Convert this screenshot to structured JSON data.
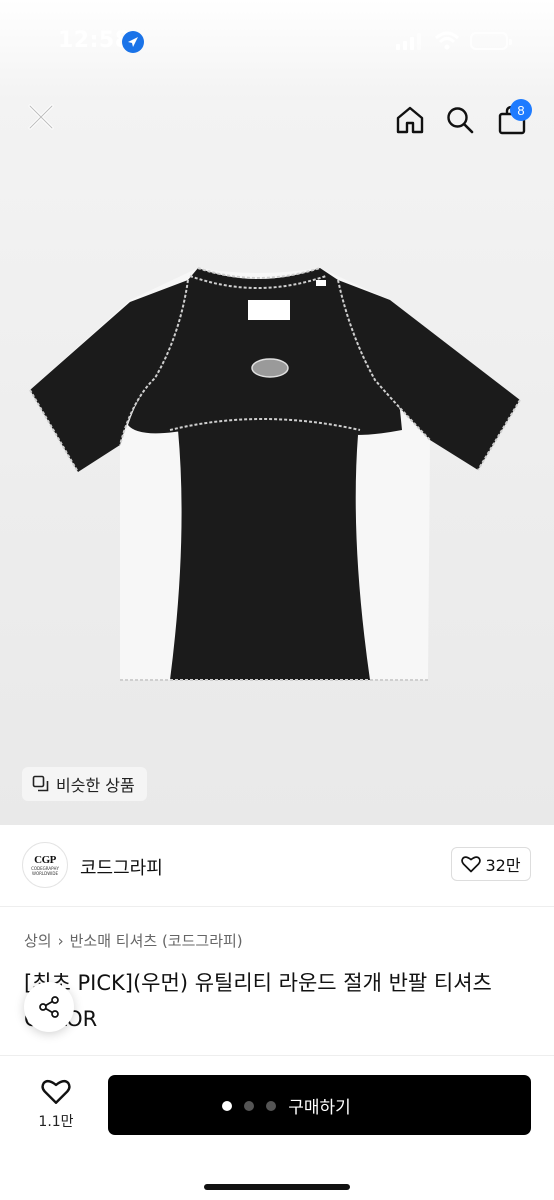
{
  "status_bar": {
    "time": "12:58"
  },
  "header": {
    "cart_count": "8"
  },
  "product": {
    "similar_label": "비슷한 상품",
    "brand": {
      "logo_text": "CGP",
      "logo_sub1": "CODEGRAPHY",
      "logo_sub2": "WORLDWIDE",
      "name": "코드그라피",
      "likes": "32만"
    },
    "breadcrumb": [
      "상의",
      "반소매 티셔츠 (코드그라피)"
    ],
    "title": "[최초 PICK](우먼) 유틸리티 라운드 절개 반팔 티셔츠 COLOR"
  },
  "bottom": {
    "wish_count": "1.1만",
    "buy_label": "구매하기"
  },
  "colors": {
    "accent": "#1e7bff",
    "buy_bg": "#000000"
  },
  "icons": [
    "close-icon",
    "home-icon",
    "search-icon",
    "cart-icon",
    "similar-icon",
    "heart-icon",
    "share-icon",
    "location-arrow-icon"
  ]
}
